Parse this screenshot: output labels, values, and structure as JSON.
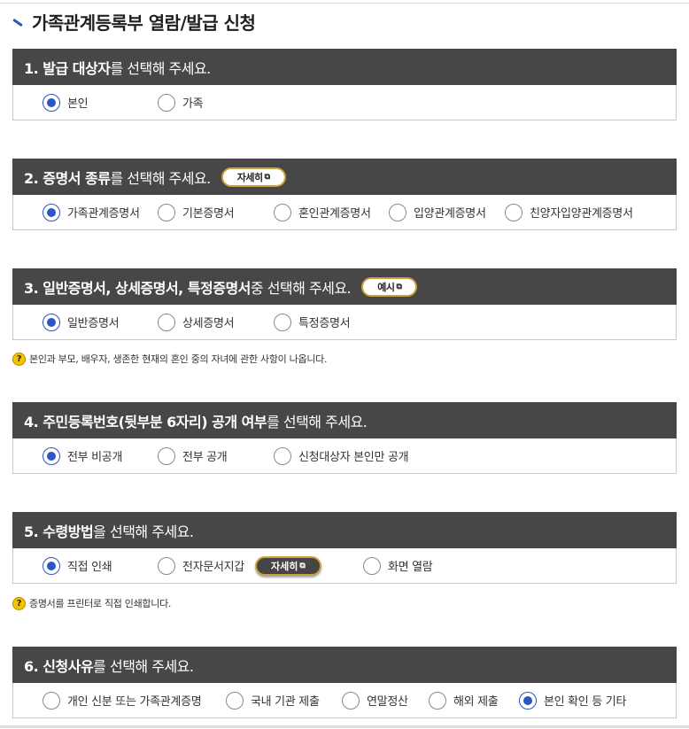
{
  "page_title": "가족관계등록부 열람/발급 신청",
  "sections": [
    {
      "title_bold": "1. 발급 대상자",
      "title_rest": "를 선택해 주세요.",
      "options": [
        {
          "label": "본인",
          "selected": true
        },
        {
          "label": "가족",
          "selected": false
        }
      ]
    },
    {
      "title_bold": "2. 증명서 종류",
      "title_rest": "를 선택해 주세요.",
      "button": "자세히",
      "options": [
        {
          "label": "가족관계증명서",
          "selected": true
        },
        {
          "label": "기본증명서",
          "selected": false
        },
        {
          "label": "혼인관계증명서",
          "selected": false
        },
        {
          "label": "입양관계증명서",
          "selected": false
        },
        {
          "label": "친양자입양관계증명서",
          "selected": false
        }
      ]
    },
    {
      "title_bold": "3. 일반증명서, 상세증명서, 특정증명서",
      "title_rest": " 중 선택해 주세요.",
      "button": "예시",
      "options": [
        {
          "label": "일반증명서",
          "selected": true
        },
        {
          "label": "상세증명서",
          "selected": false
        },
        {
          "label": "특정증명서",
          "selected": false
        }
      ],
      "note": "본인과 부모, 배우자, 생존한 현재의 혼인 중의 자녀에 관한 사항이 나옵니다."
    },
    {
      "title_bold": "4. 주민등록번호(뒷부분 6자리) 공개 여부",
      "title_rest": "를 선택해 주세요.",
      "options": [
        {
          "label": "전부 비공개",
          "selected": true
        },
        {
          "label": "전부 공개",
          "selected": false
        },
        {
          "label": "신청대상자 본인만 공개",
          "selected": false
        }
      ]
    },
    {
      "title_bold": "5. 수령방법",
      "title_rest": "을 선택해 주세요.",
      "options": [
        {
          "label": "직접 인쇄",
          "selected": true
        },
        {
          "label": "전자문서지갑",
          "selected": false
        },
        {
          "label": "화면 열람",
          "selected": false
        }
      ],
      "inline_button": "자세히",
      "note": "증명서를 프린터로 직접 인쇄합니다."
    },
    {
      "title_bold": "6. 신청사유",
      "title_rest": "를 선택해 주세요.",
      "options": [
        {
          "label": "개인 신분 또는 가족관계증명",
          "selected": false
        },
        {
          "label": "국내 기관 제출",
          "selected": false
        },
        {
          "label": "연말정산",
          "selected": false
        },
        {
          "label": "해외 제출",
          "selected": false
        },
        {
          "label": "본인 확인 등 기타",
          "selected": true
        }
      ]
    }
  ],
  "colors": {
    "header_bg": "#474747",
    "radio_selected": "#2b57c4",
    "pill_border": "#c9a33a",
    "help_icon": "#f2c300"
  },
  "icons": {
    "help": "?",
    "external_link": "⧉"
  }
}
